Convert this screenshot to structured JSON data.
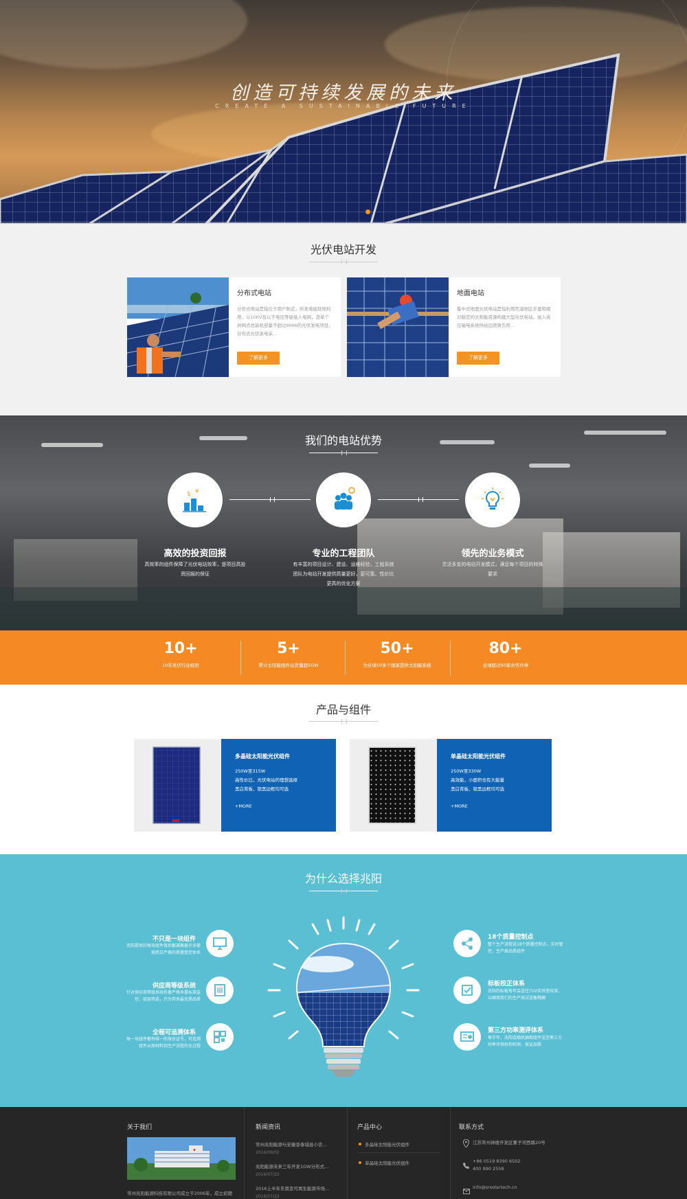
{
  "hero": {
    "title": "创造可持续发展的未来",
    "subtitle": "CREATE A SUSTAINABLE FUTURE"
  },
  "pv": {
    "title": "光伏电站开发",
    "cards": [
      {
        "title": "分布式电站",
        "desc": "分布式电站是指位于用户附近，所发电能就地利用，以10KV及以下电压等级接入电网，且单个并网点总装机容量不超过6MW的光伏发电项目。分布式光伏发电采...",
        "button": "了解更多"
      },
      {
        "title": "地面电站",
        "desc": "集中式地面光伏电站是指利用荒漠地区丰富和相对稳定的太阳能资源构建大型光伏电站，接入高压输电系统供给远距离负荷...",
        "button": "了解更多"
      }
    ]
  },
  "advantages": {
    "title": "我们的电站优势",
    "items": [
      {
        "title": "高效的投资回报",
        "desc": "高效率的组件保障了光伏电站效率，是项目高投资回报的保证"
      },
      {
        "title": "专业的工程团队",
        "desc": "有丰富的项目设计、建设、运维经验，工程系统团队为电站开发提供质量更好，更可靠、性价比更高的优化方案"
      },
      {
        "title": "领先的业务模式",
        "desc": "灵活多变的电站开发模式，满足每个项目的特殊要求"
      }
    ]
  },
  "stats": [
    {
      "num": "10+",
      "label": "10年光伏行业经验"
    },
    {
      "num": "5+",
      "label": "累计太阳能组件出货量超5GW"
    },
    {
      "num": "50+",
      "label": "为全球50多个国家提供太阳能系统"
    },
    {
      "num": "80+",
      "label": "全球超过80家合作伙伴"
    }
  ],
  "products": {
    "title": "产品与组件",
    "items": [
      {
        "name": "多晶硅太阳能光伏组件",
        "spec1": "250W至315W",
        "spec2": "高性价比，光伏电站的理想选择",
        "spec3": "黑白背板、银黑边框均可选",
        "more": "+MORE"
      },
      {
        "name": "单晶硅太阳能光伏组件",
        "spec1": "250W至330W",
        "spec2": "高效能，小面积也有大能量",
        "spec3": "黑白背板、银黑边框均可选",
        "more": "+MORE"
      }
    ]
  },
  "why": {
    "title": "为什么选择兆阳",
    "left": [
      {
        "title": "不只是一块组件",
        "desc": "兆阳提供的每块组件背后都凝聚着许多繁琐而又严格的质量管控体系"
      },
      {
        "title": "供应商等级系统",
        "desc": "针对供应商等级系统有着严格多重标准监控，层层筛选，只为带来最优质品质"
      },
      {
        "title": "全程可追溯体系",
        "desc": "每一块组件都有唯一的身份证号，可追溯组件从原材料到生产流程的全过程"
      }
    ],
    "right": [
      {
        "title": "18个质量控制点",
        "desc": "整个生产流程设18个质量控制点，实时管控，生产高品质组件"
      },
      {
        "title": "标板校正体系",
        "desc": "兆阳的标板每年会送往TUV实验室校准，以确保我们的生产测试设备精确"
      },
      {
        "title": "第三方功率测评体系",
        "desc": "每半年，兆阳会随机抽取组件送至第三方功率评测机构检测，保证品质"
      }
    ]
  },
  "footer": {
    "about": {
      "title": "关于我们",
      "text": "常州兆阳能源科技有限公司成立于2006年，成立初期"
    },
    "news": {
      "title": "新闻资讯",
      "items": [
        {
          "text": "常州兆阳能源与安徽普泰城县小农...",
          "date": "2016/09/02"
        },
        {
          "text": "兆阳能源未来三年开发1GW分布式...",
          "date": "2016/07/22"
        },
        {
          "text": "2016上半年东南亚可再生能源市场...",
          "date": "2016/07/22"
        }
      ]
    },
    "products": {
      "title": "产品中心",
      "items": [
        "多晶硅太阳能光伏组件",
        "单晶硅太阳能光伏组件"
      ]
    },
    "contact": {
      "title": "联系方式",
      "address": "江苏常州钟楼开发区董子河西路20号",
      "phone1": "+86 0519 8390 6502",
      "phone2": "400 990 2558",
      "email": "info@srsolartech.cn"
    }
  }
}
